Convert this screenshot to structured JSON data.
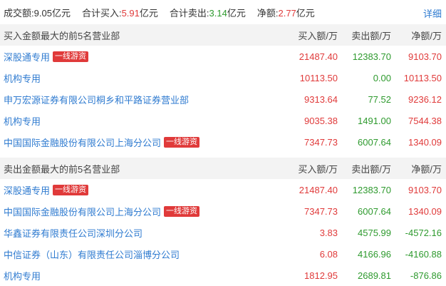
{
  "summary": {
    "turnover_label": "成交额:",
    "turnover_value": "9.05",
    "turnover_unit": "亿元",
    "buy_total_label": "合计买入:",
    "buy_total_value": "5.91",
    "buy_total_unit": "亿元",
    "sell_total_label": "合计卖出:",
    "sell_total_value": "3.14",
    "sell_total_unit": "亿元",
    "net_label": "净额:",
    "net_value": "2.77",
    "net_unit": "亿元",
    "detail_link": "详细"
  },
  "buy_section": {
    "title": "买入金额最大的前5名营业部",
    "col_buy": "买入额/万",
    "col_sell": "卖出额/万",
    "col_net": "净额/万",
    "rows": [
      {
        "name": "深股通专用",
        "tag": "一线游资",
        "buy": "21487.40",
        "sell": "12383.70",
        "net": "9103.70"
      },
      {
        "name": "机构专用",
        "tag": "",
        "buy": "10113.50",
        "sell": "0.00",
        "net": "10113.50"
      },
      {
        "name": "申万宏源证券有限公司桐乡和平路证券营业部",
        "tag": "",
        "buy": "9313.64",
        "sell": "77.52",
        "net": "9236.12"
      },
      {
        "name": "机构专用",
        "tag": "",
        "buy": "9035.38",
        "sell": "1491.00",
        "net": "7544.38"
      },
      {
        "name": "中国国际金融股份有限公司上海分公司",
        "tag": "一线游资",
        "buy": "7347.73",
        "sell": "6007.64",
        "net": "1340.09"
      }
    ]
  },
  "sell_section": {
    "title": "卖出金额最大的前5名营业部",
    "col_buy": "买入额/万",
    "col_sell": "卖出额/万",
    "col_net": "净额/万",
    "rows": [
      {
        "name": "深股通专用",
        "tag": "一线游资",
        "buy": "21487.40",
        "sell": "12383.70",
        "net": "9103.70"
      },
      {
        "name": "中国国际金融股份有限公司上海分公司",
        "tag": "一线游资",
        "buy": "7347.73",
        "sell": "6007.64",
        "net": "1340.09"
      },
      {
        "name": "华鑫证券有限责任公司深圳分公司",
        "tag": "",
        "buy": "3.83",
        "sell": "4575.99",
        "net": "-4572.16"
      },
      {
        "name": "中信证券（山东）有限责任公司淄博分公司",
        "tag": "",
        "buy": "6.08",
        "sell": "4166.96",
        "net": "-4160.88"
      },
      {
        "name": "机构专用",
        "tag": "",
        "buy": "1812.95",
        "sell": "2689.81",
        "net": "-876.86"
      }
    ]
  },
  "colors": {
    "red": "#e03a3a",
    "green": "#2e9a2e",
    "link_blue": "#2f7bd0",
    "header_bg": "#f3f3f3"
  }
}
